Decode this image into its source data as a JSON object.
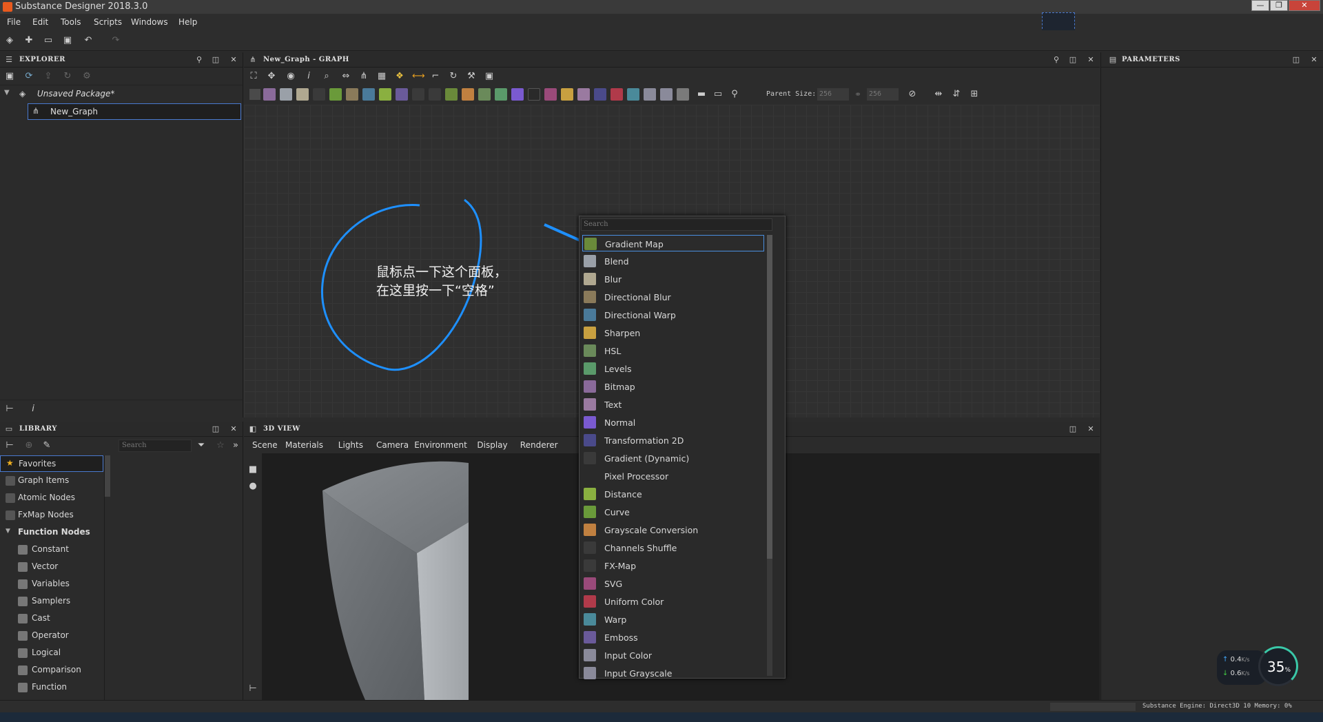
{
  "window": {
    "title": "Substance Designer 2018.3.0",
    "controls": [
      "—",
      "❐",
      "✕"
    ]
  },
  "menu": [
    "File",
    "Edit",
    "Tools",
    "Scripts",
    "Windows",
    "Help"
  ],
  "explorer": {
    "title": "EXPLORER",
    "package": "Unsaved Package*",
    "graph_item": "New_Graph"
  },
  "graph": {
    "title": "New_Graph - GRAPH",
    "parent_size_label": "Parent Size:",
    "size_a": "256",
    "size_b": "256"
  },
  "params": {
    "title": "PARAMETERS"
  },
  "annotation": {
    "line1": "鼠标点一下这个面板，",
    "line2": "在这里按一下“空格”"
  },
  "popup": {
    "search_placeholder": "Search",
    "items": [
      {
        "label": "Gradient Map",
        "color": "#6a8a3a",
        "selected": true
      },
      {
        "label": "Blend",
        "color": "#9aa0a8"
      },
      {
        "label": "Blur",
        "color": "#b0a890"
      },
      {
        "label": "Directional Blur",
        "color": "#8a7a5a"
      },
      {
        "label": "Directional Warp",
        "color": "#4a7a9a"
      },
      {
        "label": "Sharpen",
        "color": "#c8a040"
      },
      {
        "label": "HSL",
        "color": "#6a8a5a"
      },
      {
        "label": "Levels",
        "color": "#5a9a6a"
      },
      {
        "label": "Bitmap",
        "color": "#8a6a9a"
      },
      {
        "label": "Text",
        "color": "#9a7aa0"
      },
      {
        "label": "Normal",
        "color": "#7a5ad0"
      },
      {
        "label": "Transformation 2D",
        "color": "#4a4a8a"
      },
      {
        "label": "Gradient (Dynamic)",
        "color": "#3a3a3a"
      },
      {
        "label": "Pixel Processor",
        "color": "#2a2a2a"
      },
      {
        "label": "Distance",
        "color": "#8ab040"
      },
      {
        "label": "Curve",
        "color": "#6a9a3a"
      },
      {
        "label": "Grayscale Conversion",
        "color": "#c08040"
      },
      {
        "label": "Channels Shuffle",
        "color": "#3a3a3a"
      },
      {
        "label": "FX-Map",
        "color": "#3a3a3a"
      },
      {
        "label": "SVG",
        "color": "#9a4a7a"
      },
      {
        "label": "Uniform Color",
        "color": "#b03a4a"
      },
      {
        "label": "Warp",
        "color": "#4a8a9a"
      },
      {
        "label": "Emboss",
        "color": "#6a5a9a"
      },
      {
        "label": "Input Color",
        "color": "#8a8a9a"
      },
      {
        "label": "Input Grayscale",
        "color": "#8a8a9a"
      }
    ]
  },
  "library": {
    "title": "LIBRARY",
    "search_placeholder": "Search",
    "items": [
      {
        "label": "Favorites",
        "sub": false
      },
      {
        "label": "Graph Items",
        "sub": false
      },
      {
        "label": "Atomic Nodes",
        "sub": false
      },
      {
        "label": "FxMap Nodes",
        "sub": false
      },
      {
        "label": "Function Nodes",
        "sub": false
      },
      {
        "label": "Constant",
        "sub": true
      },
      {
        "label": "Vector",
        "sub": true
      },
      {
        "label": "Variables",
        "sub": true
      },
      {
        "label": "Samplers",
        "sub": true
      },
      {
        "label": "Cast",
        "sub": true
      },
      {
        "label": "Operator",
        "sub": true
      },
      {
        "label": "Logical",
        "sub": true
      },
      {
        "label": "Comparison",
        "sub": true
      },
      {
        "label": "Function",
        "sub": true
      }
    ]
  },
  "view3d": {
    "title": "3D VIEW",
    "menu": [
      "Scene",
      "Materials",
      "Lights",
      "Camera",
      "Environment",
      "Display",
      "Renderer"
    ]
  },
  "net": {
    "up": "0.4",
    "down": "0.6",
    "unit": "K/s",
    "percent": "35",
    "percent_sign": "%"
  },
  "status": {
    "text": "Substance Engine: Direct3D 10 Memory: 0%"
  }
}
